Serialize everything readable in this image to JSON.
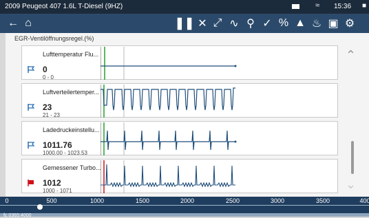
{
  "vehicle_title": "2009 Peugeot 407 1.6L T-Diesel (9HZ)",
  "clock": "15:36",
  "section_header": "EGR-Ventilöffnungsregel.(%)",
  "parameters": [
    {
      "name": "Lufttemperatur Flu...",
      "value": "0",
      "range": "0 - 0",
      "flag": "blue-flag-icon",
      "flag_color": "#2a6fb5"
    },
    {
      "name": "Luftverteilertemper...",
      "value": "23",
      "range": "21 - 23",
      "flag": "blue-flag-icon",
      "flag_color": "#2a6fb5"
    },
    {
      "name": "Ladedruckeinstellu...",
      "value": "1011.76",
      "range": "1000.00 - 1023.53",
      "flag": "blue-flag-icon",
      "flag_color": "#2a6fb5"
    },
    {
      "name": "Gemessener Turbo...",
      "value": "1012",
      "range": "1000 - 1071",
      "flag": "red-flag-icon",
      "flag_color": "#d0101a"
    }
  ],
  "timeline": {
    "labels": [
      "0",
      "500",
      "1000",
      "1500",
      "2000",
      "2500",
      "3000",
      "3500",
      "400"
    ],
    "selection": "fc  0365:4000"
  },
  "colors": {
    "trace": "#1f4e7a",
    "cursor_green": "#23a02a",
    "cursor_gray": "#b9b9b9",
    "cursor_red": "#d0101a"
  }
}
